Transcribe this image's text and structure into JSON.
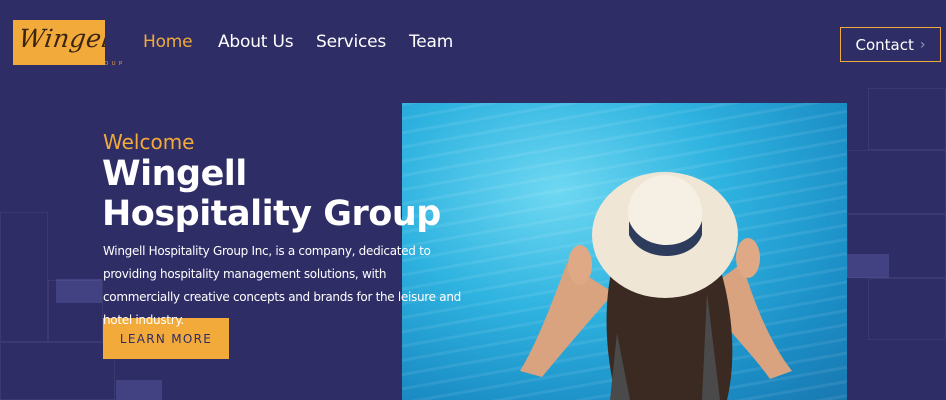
{
  "brand": {
    "logo_script": "Wingell",
    "logo_sub": "HOSPITALITY GROUP"
  },
  "nav": {
    "items": [
      {
        "label": "Home",
        "active": true
      },
      {
        "label": "About Us",
        "active": false
      },
      {
        "label": "Services",
        "active": false
      },
      {
        "label": "Team",
        "active": false
      }
    ],
    "contact_label": "Contact",
    "contact_icon": "chevron-right-icon"
  },
  "hero": {
    "eyebrow": "Welcome",
    "title_line1": "Wingell",
    "title_line2": "Hospitality Group",
    "description": "Wingell Hospitality Group Inc, is a company, dedicated to providing hospitality management solutions, with commercially creative concepts and brands for the leisure and hotel industry.",
    "cta_label": "LEARN MORE",
    "image_icon": "woman-in-pool-photo"
  },
  "colors": {
    "background": "#2f2d66",
    "accent": "#f2aa3a",
    "text": "#ffffff"
  }
}
